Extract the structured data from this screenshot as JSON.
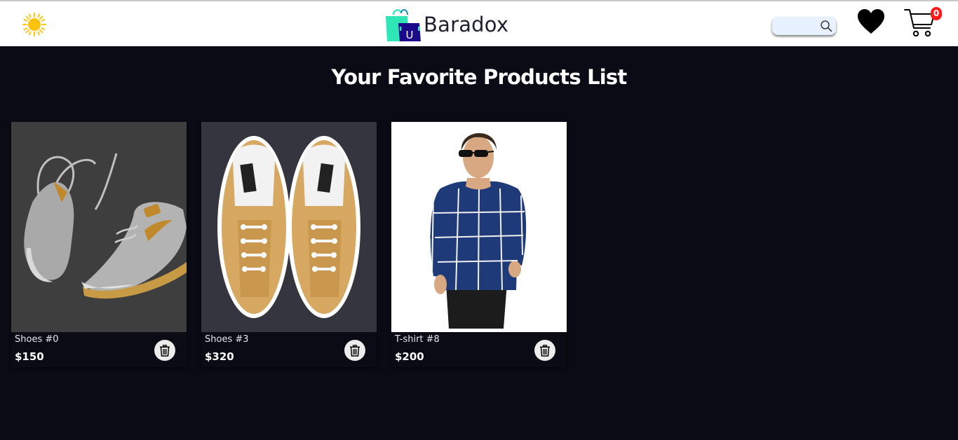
{
  "header": {
    "brand_name": "Baradox",
    "logo_letter": "U",
    "search_placeholder": "",
    "cart_count": "0",
    "icons": {
      "theme": "sun-icon",
      "search": "search-icon",
      "favorites": "heart-icon",
      "cart": "cart-icon"
    }
  },
  "main": {
    "title": "Your Favorite Products List",
    "products": [
      {
        "name": "Shoes #0",
        "price": "$150"
      },
      {
        "name": "Shoes #3",
        "price": "$320"
      },
      {
        "name": "T-shirt #8",
        "price": "$200"
      }
    ]
  },
  "colors": {
    "background": "#0b0b16",
    "header_bg": "#ffffff",
    "badge": "#ff1a1a",
    "sun": "#ffc20e",
    "bag_teal": "#2ee6b6",
    "bag_navy": "#1a0a8a"
  }
}
